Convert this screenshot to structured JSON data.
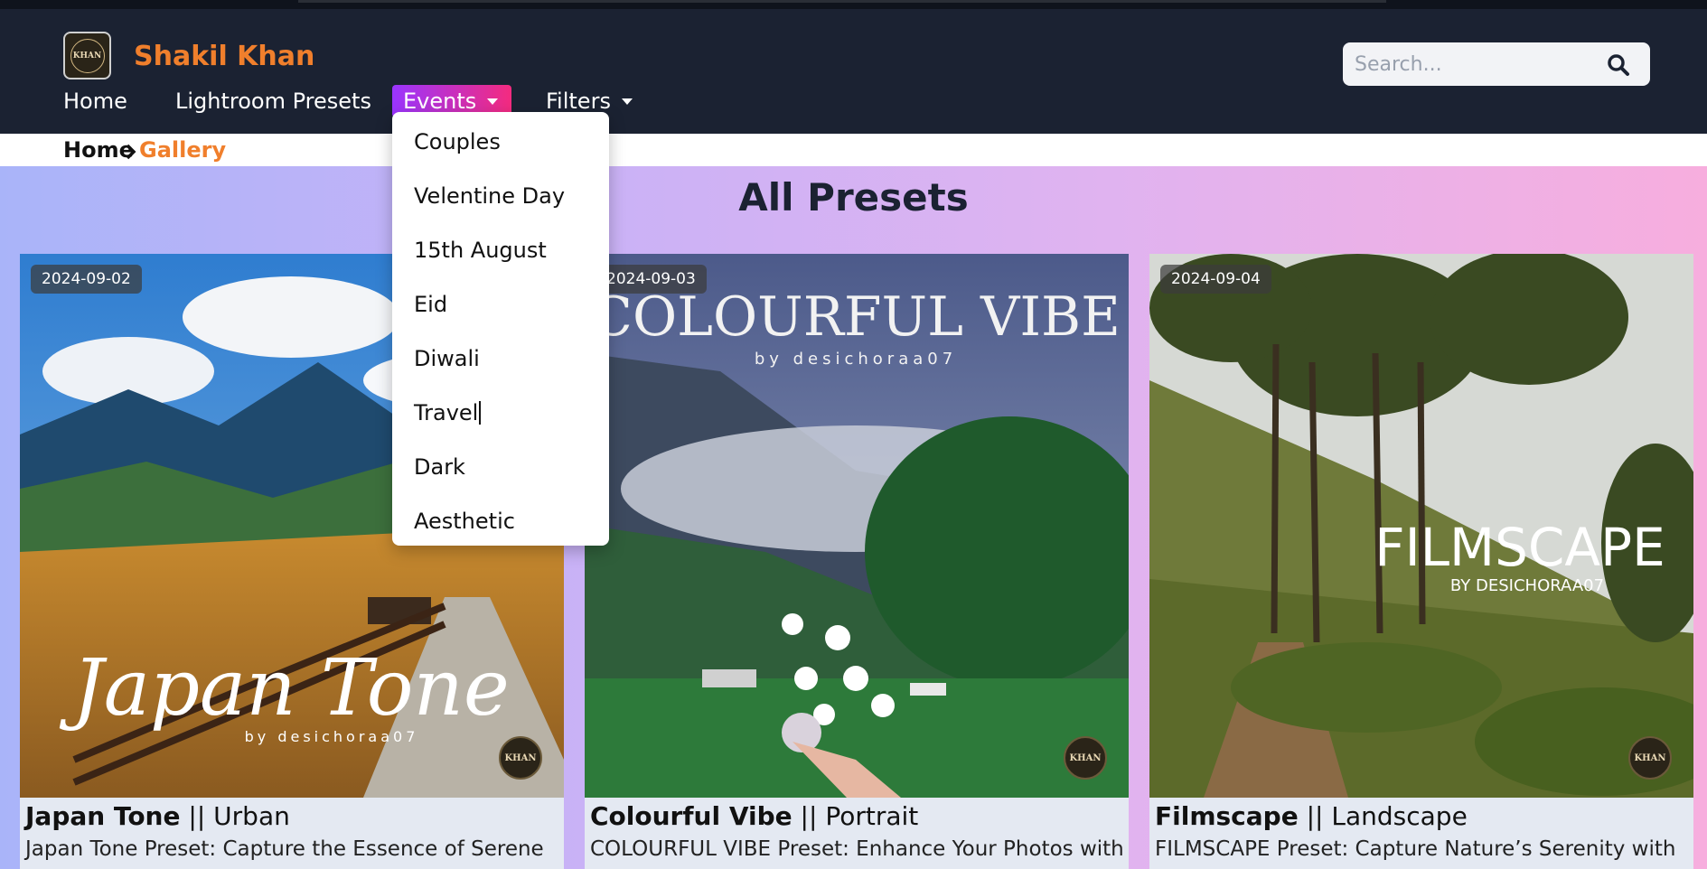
{
  "brand": {
    "name": "Shakil Khan",
    "logo_text": "KHAN"
  },
  "nav": {
    "home": "Home",
    "lightroom_presets": "Lightroom Presets",
    "events": "Events",
    "filters": "Filters"
  },
  "search": {
    "placeholder": "Search..."
  },
  "breadcrumb": {
    "home": "Home",
    "current": "Gallery"
  },
  "main": {
    "title": "All Presets"
  },
  "events_menu": [
    "Couples",
    "Velentine Day",
    "15th August",
    "Eid",
    "Diwali",
    "Travel",
    "Dark",
    "Aesthetic"
  ],
  "cards": [
    {
      "date": "2024-09-02",
      "name": "Japan Tone",
      "separator": "||",
      "category": "Urban",
      "description": "Japan Tone Preset: Capture the Essence of Serene",
      "overlay_title": "Japan Tone",
      "overlay_by": "by desichoraa07",
      "badge": "KHAN"
    },
    {
      "date": "2024-09-03",
      "name": "Colourful Vibe",
      "separator": "||",
      "category": "Portrait",
      "description": "COLOURFUL VIBE Preset: Enhance Your Photos with",
      "overlay_title": "COLOURFUL VIBE",
      "overlay_by": "by desichoraa07",
      "badge": "KHAN"
    },
    {
      "date": "2024-09-04",
      "name": "Filmscape",
      "separator": "||",
      "category": "Landscape",
      "description": "FILMSCAPE Preset: Capture Nature’s Serenity with",
      "overlay_title": "FILMSCAPE",
      "overlay_by": "BY DESICHORAA07",
      "badge": "KHAN"
    }
  ],
  "colors": {
    "header_bg": "#1b2232",
    "accent_orange": "#f07f2c",
    "events_gradient_start": "#9a35ff",
    "events_gradient_end": "#f42b7f"
  },
  "icons": {
    "search": "search-icon",
    "breadcrumb_sep": "chevron-right-icon",
    "dropdown": "caret-down-icon"
  }
}
